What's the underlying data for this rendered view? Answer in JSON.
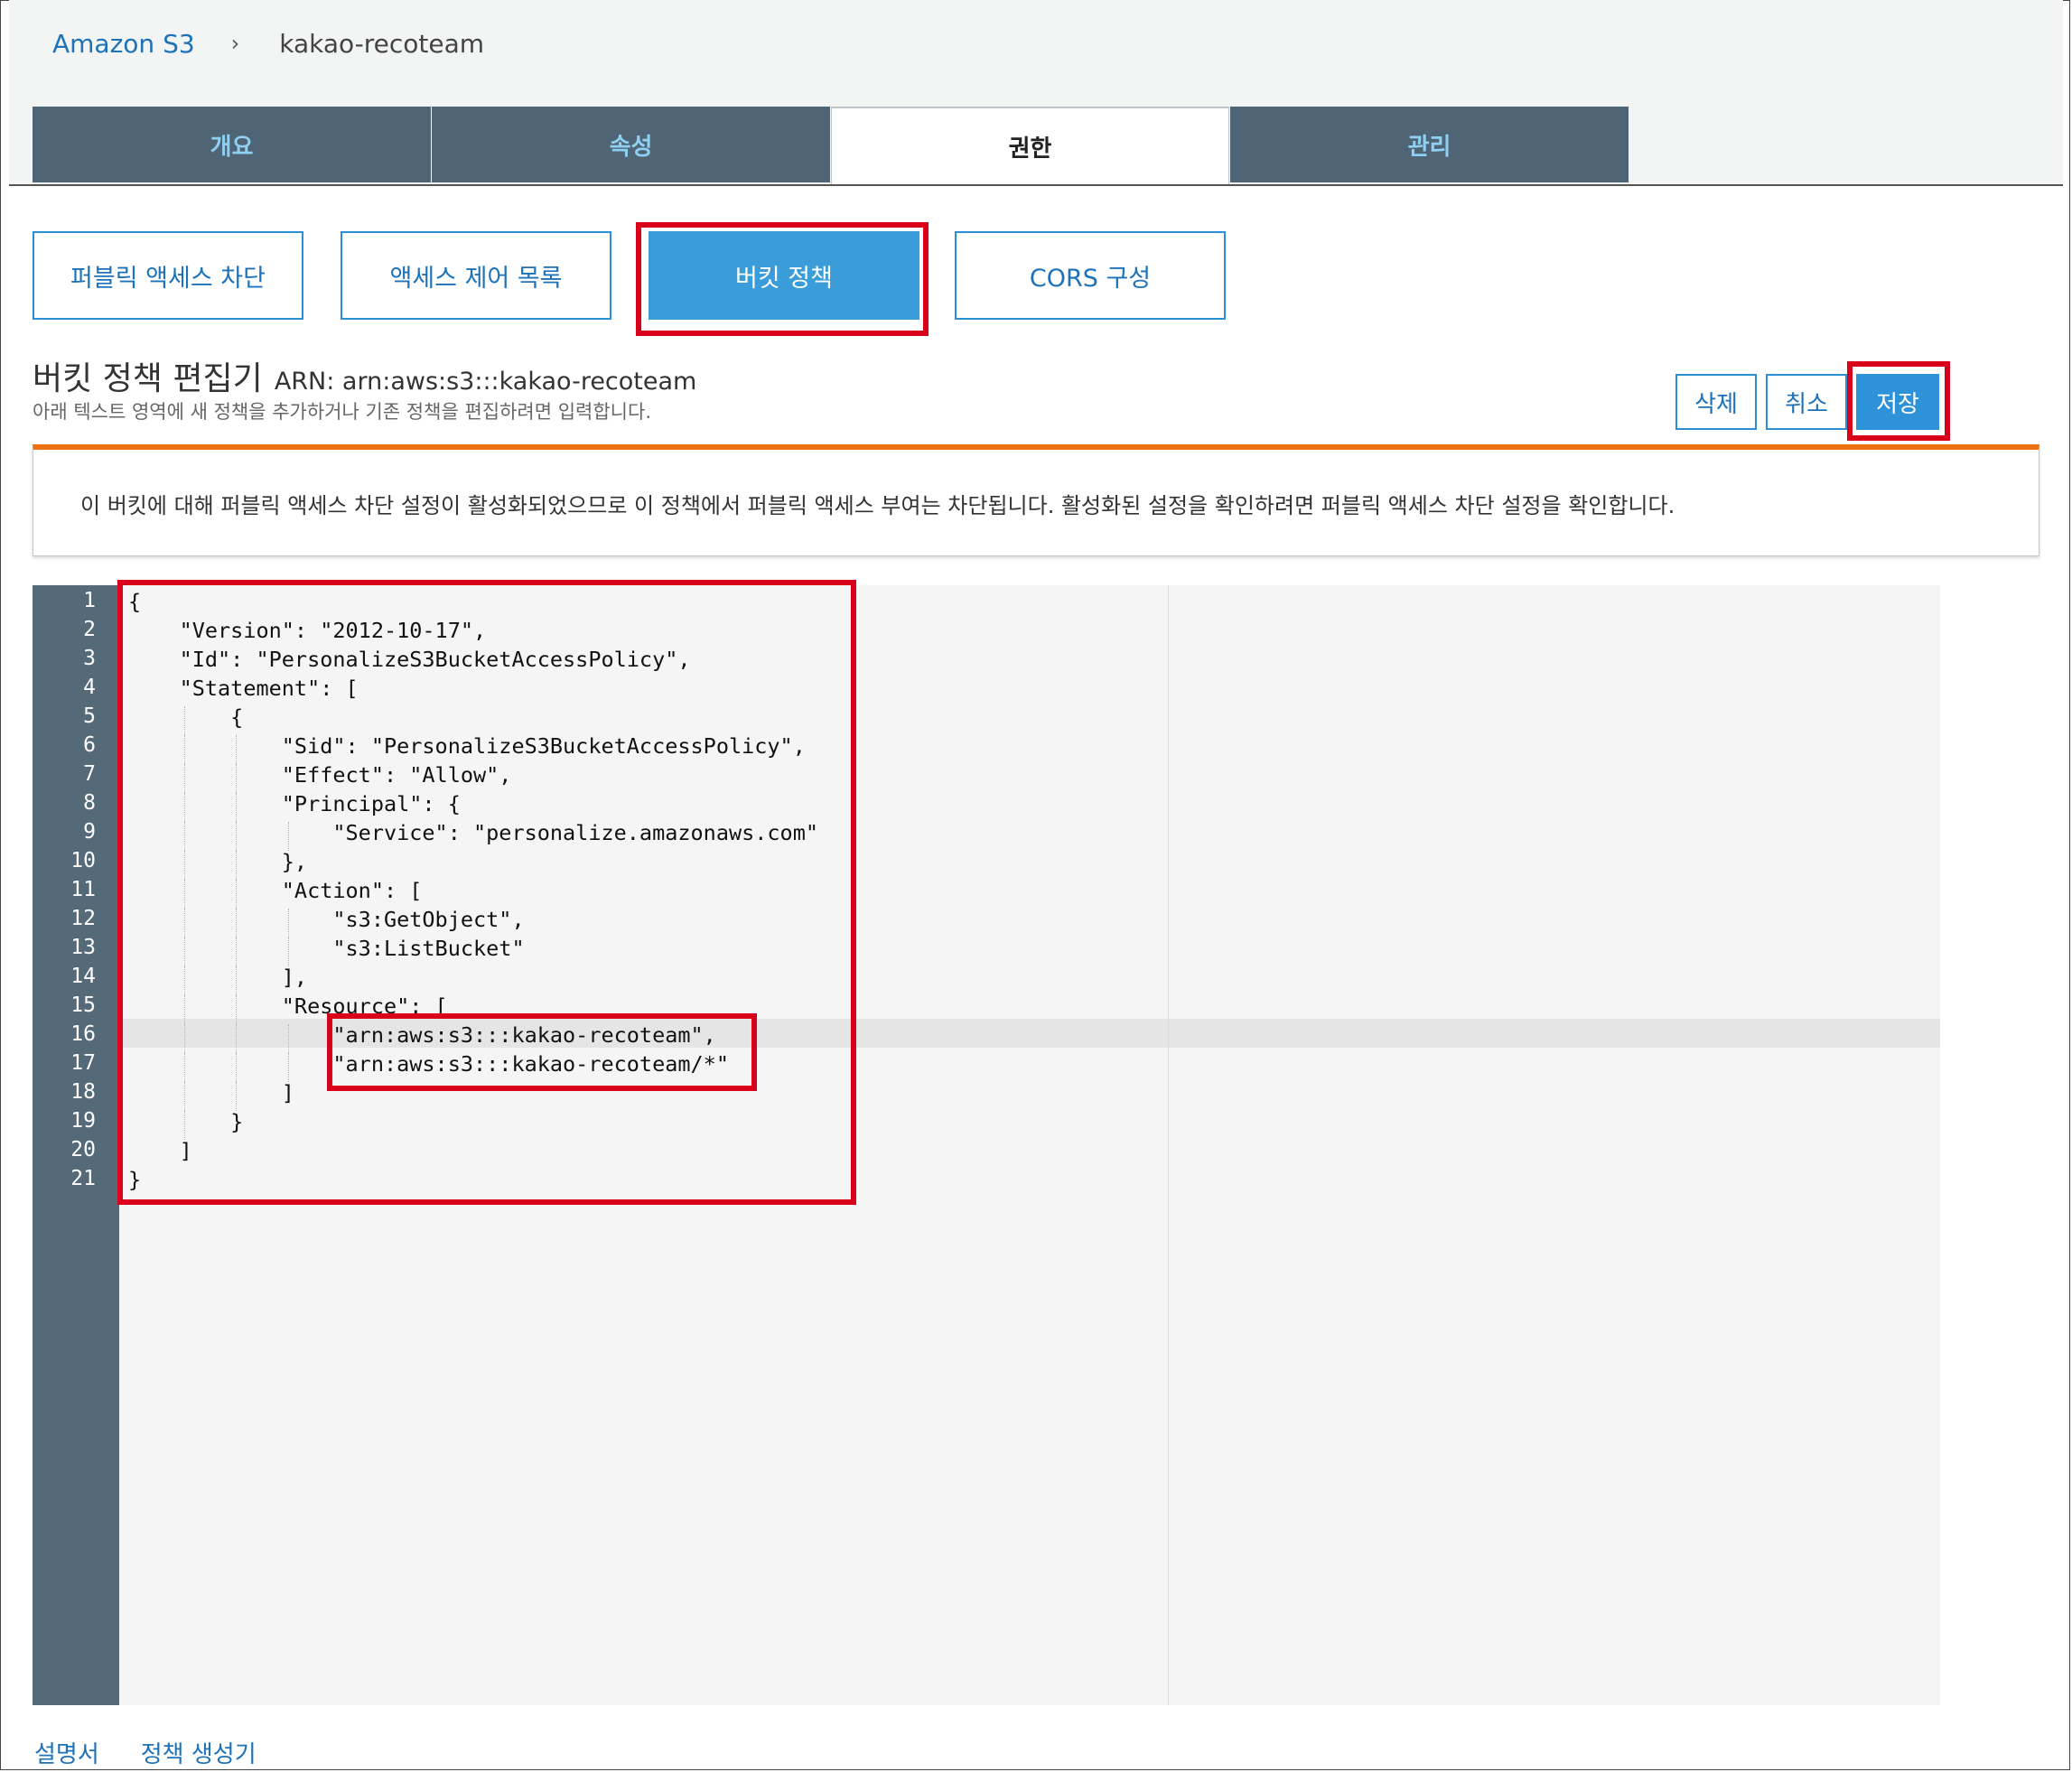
{
  "breadcrumb": {
    "root": "Amazon S3",
    "separator": "›",
    "current": "kakao-recoteam"
  },
  "tabs": [
    {
      "label": "개요",
      "active": false
    },
    {
      "label": "속성",
      "active": false
    },
    {
      "label": "권한",
      "active": true
    },
    {
      "label": "관리",
      "active": false
    }
  ],
  "subtabs": [
    {
      "label": "퍼블릭 액세스 차단",
      "active": false
    },
    {
      "label": "액세스 제어 목록",
      "active": false
    },
    {
      "label": "버킷 정책",
      "active": true
    },
    {
      "label": "CORS 구성",
      "active": false
    }
  ],
  "editor_header": {
    "title": "버킷 정책 편집기",
    "arn": "ARN: arn:aws:s3:::kakao-recoteam",
    "description": "아래 텍스트 영역에 새 정책을 추가하거나 기존 정책을 편집하려면 입력합니다."
  },
  "actions": {
    "delete_label": "삭제",
    "cancel_label": "취소",
    "save_label": "저장"
  },
  "notice": {
    "text": "이 버킷에 대해 퍼블릭 액세스 차단 설정이 활성화되었으므로 이 정책에서 퍼블릭 액세스 부여는 차단됩니다. 활성화된 설정을 확인하려면 퍼블릭 액세스 차단 설정을 확인합니다."
  },
  "code_lines": [
    "{",
    "    \"Version\": \"2012-10-17\",",
    "    \"Id\": \"PersonalizeS3BucketAccessPolicy\",",
    "    \"Statement\": [",
    "        {",
    "            \"Sid\": \"PersonalizeS3BucketAccessPolicy\",",
    "            \"Effect\": \"Allow\",",
    "            \"Principal\": {",
    "                \"Service\": \"personalize.amazonaws.com\"",
    "            },",
    "            \"Action\": [",
    "                \"s3:GetObject\",",
    "                \"s3:ListBucket\"",
    "            ],",
    "            \"Resource\": [",
    "                \"arn:aws:s3:::kakao-recoteam\",",
    "                \"arn:aws:s3:::kakao-recoteam/*\"",
    "            ]",
    "        }",
    "    ]",
    "}"
  ],
  "footer": {
    "docs_label": "설명서",
    "policy_generator_label": "정책 생성기"
  },
  "colors": {
    "tab_bg": "#4f6474",
    "tab_text": "#8fd0f2",
    "accent_blue": "#2d92d8",
    "link_blue": "#1d72b8",
    "warning_orange": "#ec7211",
    "highlight_red": "#d9001b",
    "gutter": "#546a78"
  }
}
